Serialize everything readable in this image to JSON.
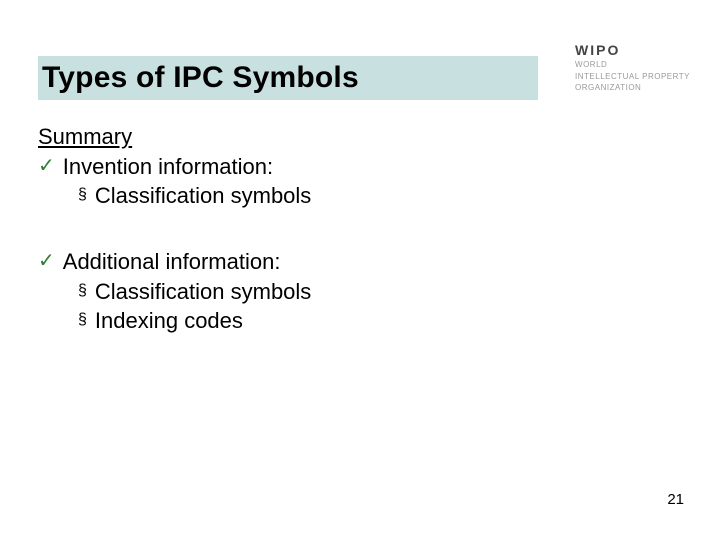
{
  "logo": {
    "main": "WIPO",
    "sub1": "WORLD",
    "sub2": "INTELLECTUAL PROPERTY",
    "sub3": "ORGANIZATION"
  },
  "title": "Types of IPC Symbols",
  "summary_label": "Summary",
  "section1": {
    "heading": "Invention information:",
    "items": [
      "Classification symbols"
    ]
  },
  "section2": {
    "heading": "Additional information:",
    "items": [
      "Classification symbols",
      "Indexing codes"
    ]
  },
  "page_number": "21"
}
